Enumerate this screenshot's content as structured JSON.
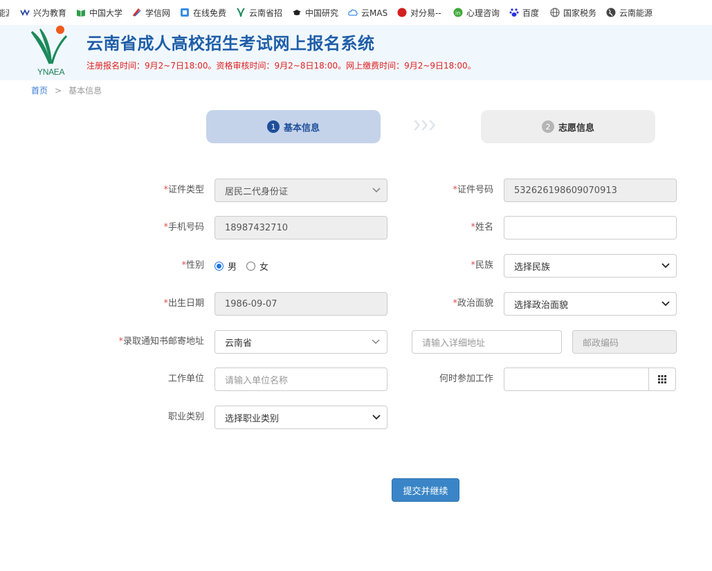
{
  "bookmarks": [
    {
      "label": "能源",
      "icon": "page-icon"
    },
    {
      "label": "兴为教育",
      "icon": "xingwei-icon"
    },
    {
      "label": "中国大学",
      "icon": "book-icon"
    },
    {
      "label": "学信网",
      "icon": "xuexin-icon"
    },
    {
      "label": "在线免费",
      "icon": "online-icon"
    },
    {
      "label": "云南省招",
      "icon": "ynaea-icon"
    },
    {
      "label": "中国研究",
      "icon": "graduation-cap-icon"
    },
    {
      "label": "云MAS",
      "icon": "cloud-icon"
    },
    {
      "label": "对分易--",
      "icon": "red-circle-icon"
    },
    {
      "label": "心理咨询",
      "icon": "in-icon"
    },
    {
      "label": "百度",
      "icon": "baidu-paw-icon"
    },
    {
      "label": "国家税务",
      "icon": "globe-icon"
    },
    {
      "label": "云南能源",
      "icon": "globe-dark-icon"
    }
  ],
  "header": {
    "logo_text": "YNAEA",
    "title": "云南省成人高校招生考试网上报名系统",
    "notice": "注册报名时间：9月2~7日18:00。资格审核时间：9月2~8日18:00。网上缴费时间：9月2~9日18:00。"
  },
  "breadcrumb": {
    "home": "首页",
    "sep": ">",
    "current": "基本信息"
  },
  "steps": [
    {
      "num": "1",
      "label": "基本信息",
      "active": true
    },
    {
      "num": "2",
      "label": "志愿信息",
      "active": false
    }
  ],
  "form": {
    "id_type": {
      "label": "证件类型",
      "value": "居民二代身份证"
    },
    "id_number": {
      "label": "证件号码",
      "value": "532626198609070913"
    },
    "phone": {
      "label": "手机号码",
      "value": "18987432710"
    },
    "name": {
      "label": "姓名",
      "value": ""
    },
    "gender": {
      "label": "性别",
      "options": [
        "男",
        "女"
      ],
      "selected": "男"
    },
    "ethnicity": {
      "label": "民族",
      "value": "选择民族"
    },
    "birth_date": {
      "label": "出生日期",
      "value": "1986-09-07"
    },
    "political_status": {
      "label": "政治面貌",
      "value": "选择政治面貌"
    },
    "mail_address": {
      "label": "录取通知书邮寄地址",
      "province": "云南省",
      "detail_placeholder": "请输入详细地址",
      "postcode_placeholder": "邮政编码"
    },
    "work_unit": {
      "label": "工作单位",
      "placeholder": "请输入单位名称"
    },
    "work_start": {
      "label": "何时参加工作",
      "value": ""
    },
    "occupation": {
      "label": "职业类别",
      "value": "选择职业类别"
    },
    "required_mark": "*"
  },
  "submit_label": "提交并继续",
  "colors": {
    "title": "#1f5ea8",
    "notice": "#e02020",
    "step_active_bg": "#c5d3ea",
    "button": "#3a85c7"
  }
}
